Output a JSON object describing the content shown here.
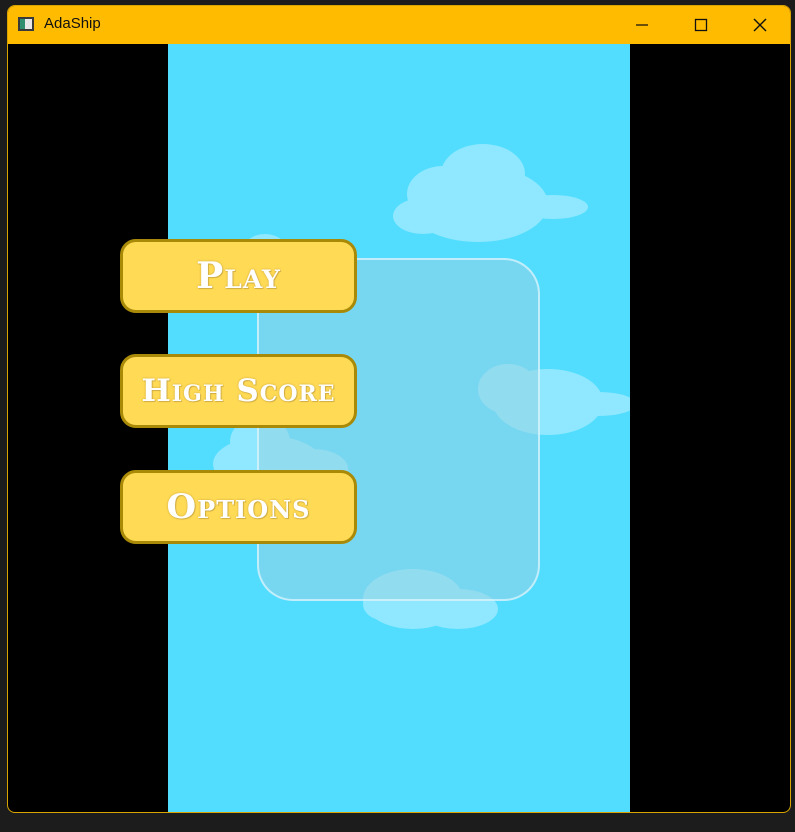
{
  "window": {
    "title": "AdaShip",
    "icon": "app-window-icon",
    "controls": {
      "minimize_icon": "minimize-icon",
      "maximize_icon": "maximize-icon",
      "close_icon": "close-icon"
    }
  },
  "menu": {
    "play_label": "Play",
    "high_score_label": "High Score",
    "options_label": "Options"
  },
  "colors": {
    "titlebar": "#ffbb00",
    "sky": "#52ddff",
    "button_fill": "#ffda55",
    "button_border": "#a98a08",
    "letterbox": "#000000"
  }
}
